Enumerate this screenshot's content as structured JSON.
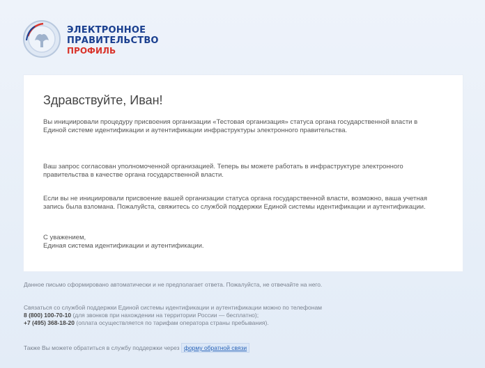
{
  "brand": {
    "line1": "ЭЛЕКТРОННОЕ",
    "line2": "ПРАВИТЕЛЬСТВО",
    "line3": "ПРОФИЛЬ",
    "logo_icon": "coat-of-arms-icon",
    "colors": {
      "primary": "#1a3f8f",
      "accent": "#d9342b",
      "link": "#2a64b8"
    }
  },
  "email": {
    "greeting": "Здравствуйте, Иван!",
    "paragraph1": "Вы инициировали процедуру присвоения организации «Тестовая организация» статуса органа государственной власти в Единой системе идентификации и аутентификации инфраструктуры электронного правительства.",
    "paragraph2": "Ваш запрос согласован уполномоченной организацией. Теперь вы можете работать в инфраструктуре электронного правительства в качестве органа государственной власти.",
    "paragraph3": "Если вы не инициировали присвоение вашей организации статуса органа государственной власти, возможно, ваша учетная запись была взломана. Пожалуйста, свяжитесь со службой поддержки Единой системы идентификации и аутентификации.",
    "signature_line1": "С уважением,",
    "signature_line2": "Единая система идентификации и аутентификации."
  },
  "footer": {
    "note": "Данное письмо сформировано автоматически и не предполагает ответа. Пожалуйста, не отвечайте на него.",
    "support_line1": "Связаться со службой поддержки Единой системы идентификации и аутентификации можно по телефонам",
    "support_phone1": "8 (800) 100-70-10",
    "support_line2": "(для звонков при нахождении на территории России — бесплатно);",
    "support_phone2": "+7 (495) 368-18-20",
    "support_line3": "(оплата осуществляется по тарифам оператора страны пребывания).",
    "feedback_text": "Также Вы можете обратиться в службу поддержки через",
    "feedback_link": "форму обратной связи"
  }
}
